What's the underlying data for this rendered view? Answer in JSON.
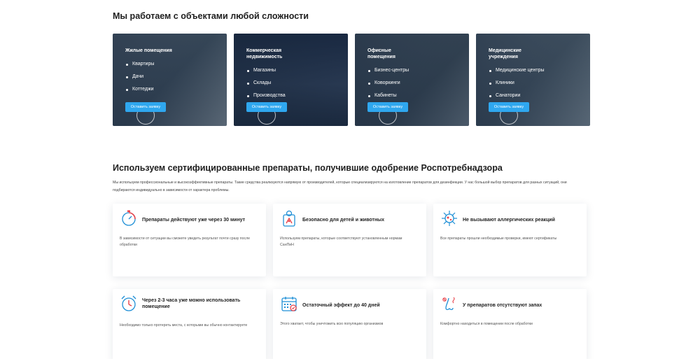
{
  "objects": {
    "heading": "Мы работаем с объектами любой сложности",
    "cards": [
      {
        "title": "Жилые помещения",
        "items": [
          "Квартиры",
          "Дачи",
          "Коттеджи"
        ],
        "button": "Оставить заявку",
        "bg": "#6d7f8c"
      },
      {
        "title": "Коммерческая недвижимость",
        "items": [
          "Магазины",
          "Склады",
          "Производства"
        ],
        "button": "Оставить заявку",
        "bg": "#243552"
      },
      {
        "title": "Офисные помещения",
        "items": [
          "Бизнес-центры",
          "Коворкинги",
          "Кабинеты"
        ],
        "button": "Оставить заявку",
        "bg": "#5f6f7a"
      },
      {
        "title": "Медицинские учреждения",
        "items": [
          "Медицинские центры",
          "Клиники",
          "Санатории"
        ],
        "button": "Оставить заявку",
        "bg": "#7c8e98"
      }
    ]
  },
  "preparations": {
    "heading": "Используем сертифицированные препараты, получившие одобрение Роспотребнадзора",
    "lead": "Мы используем профессиональные и высокоэффективные препараты. Такие средства реализуются напрямую от производителей, которые специализируются на изготовление препаратов для дезинфекции. У нас большой выбор препаратов для разных ситуаций, они подбираются индивидуально в зависимости от характера проблемы.",
    "features": [
      {
        "icon": "stopwatch-icon",
        "title": "Препараты действуют уже через 30 минут",
        "desc": "В зависимости от ситуации вы сможете увидеть результат почти сразу после обработки"
      },
      {
        "icon": "child-safety-icon",
        "title": "Безопасно для детей и животных",
        "desc": "Используем препараты, которые соответствуют установленным нормам СанПиН"
      },
      {
        "icon": "virus-icon",
        "title": "Не вызывают аллергических реакций",
        "desc": "Все препараты прошли необходимые проверки, имеют сертификаты"
      },
      {
        "icon": "alarm-clock-icon",
        "title": "Через 2-3 часа уже можно использовать помещение",
        "desc": "Необходимо только протереть места, с которыми вы обычно контактируете"
      },
      {
        "icon": "calendar-icon",
        "title": "Остаточный эффект до 40 дней",
        "desc": "Этого хватает, чтобы уничтожить всю популяцию организмов"
      },
      {
        "icon": "nose-icon",
        "title": "У препаратов отсутствуют запах",
        "desc": "Комфортно находиться в помещении после обработки"
      }
    ]
  },
  "colors": {
    "accent": "#2fa7ef",
    "icon_blue": "#1f8fd6",
    "icon_red": "#e8424a"
  }
}
